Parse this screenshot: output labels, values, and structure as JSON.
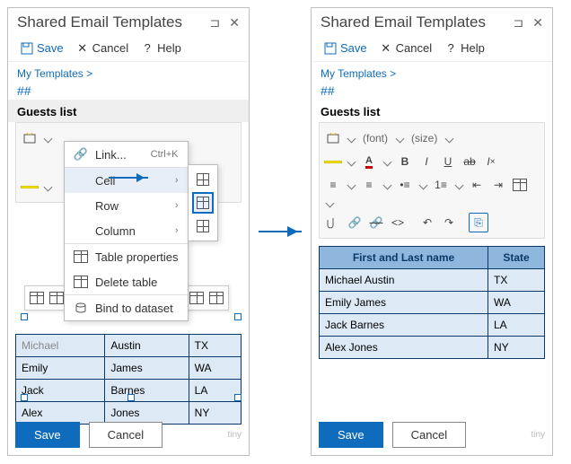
{
  "app_title": "Shared Email Templates",
  "commands": {
    "save": "Save",
    "cancel": "Cancel",
    "help": "Help"
  },
  "breadcrumb": "My Templates >",
  "hash": "##",
  "template_title": "Guests list",
  "font_label": "(font)",
  "size_label": "(size)",
  "context": {
    "link": "Link...",
    "link_shortcut": "Ctrl+K",
    "cell": "Cell",
    "row": "Row",
    "column": "Column",
    "table_props": "Table properties",
    "delete_table": "Delete table",
    "bind": "Bind to dataset"
  },
  "left_table": {
    "rows": [
      [
        "Michael",
        "Austin",
        "TX"
      ],
      [
        "Emily",
        "James",
        "WA"
      ],
      [
        "Jack",
        "Barnes",
        "LA"
      ],
      [
        "Alex",
        "Jones",
        "NY"
      ]
    ]
  },
  "right_table": {
    "headers": [
      "First and Last name",
      "State"
    ],
    "rows": [
      [
        "Michael Austin",
        "TX"
      ],
      [
        "Emily James",
        "WA"
      ],
      [
        "Jack Barnes",
        "LA"
      ],
      [
        "Alex Jones",
        "NY"
      ]
    ]
  },
  "footer": {
    "save": "Save",
    "cancel": "Cancel",
    "tiny": "tiny"
  }
}
